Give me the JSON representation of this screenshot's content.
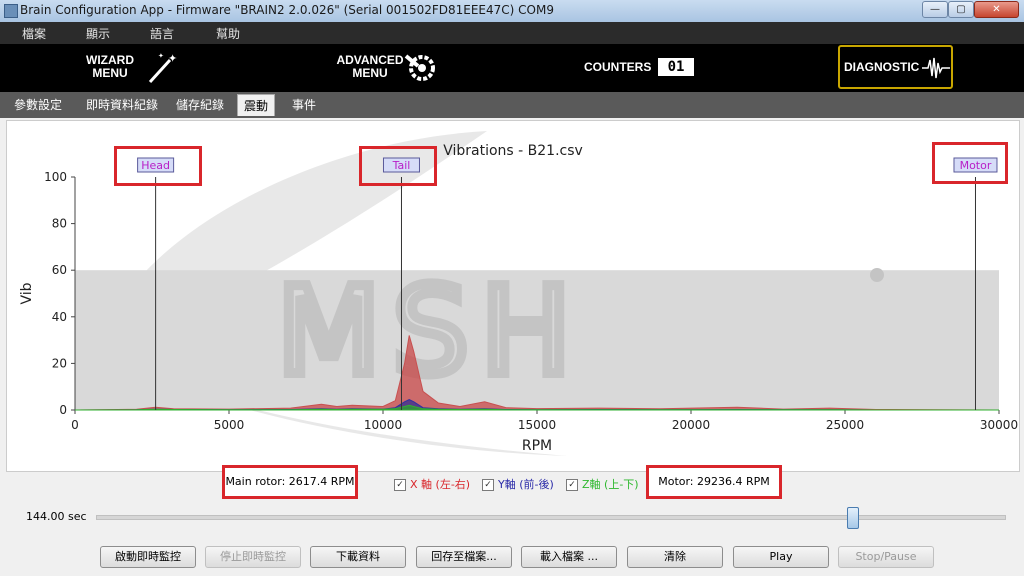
{
  "window": {
    "title": "Brain Configuration App - Firmware \"BRAIN2 2.0.026\" (Serial 001502FD81EEE47C)  COM9",
    "min": "—",
    "max": "▢",
    "close": "✕"
  },
  "menu": {
    "items": [
      "檔案",
      "顯示",
      "語言",
      "幫助"
    ]
  },
  "nav": {
    "wizard": "WIZARD MENU",
    "advanced": "ADVANCED MENU",
    "counters": "COUNTERS",
    "counters_digits": "01",
    "diagnostic": "DIAGNOSTIC"
  },
  "tabs": [
    {
      "label": "參數設定"
    },
    {
      "label": "即時資料紀錄"
    },
    {
      "label": "儲存紀錄"
    },
    {
      "label": "震動",
      "active": true
    },
    {
      "label": "事件"
    }
  ],
  "chart_data": {
    "type": "area",
    "title": "Vibrations - B21.csv",
    "xlabel": "RPM",
    "ylabel": "Vib",
    "xlim": [
      0,
      30000
    ],
    "ylim": [
      0,
      100
    ],
    "x_ticks": [
      0,
      5000,
      10000,
      15000,
      20000,
      25000,
      30000
    ],
    "y_ticks": [
      0,
      20,
      40,
      60,
      80,
      100
    ],
    "markers": [
      {
        "label": "Head",
        "x": 2617.4
      },
      {
        "label": "Tail",
        "x": 10600
      },
      {
        "label": "Motor",
        "x": 29236.4
      }
    ],
    "x": [
      0,
      2000,
      2617,
      3200,
      5000,
      7000,
      8000,
      8500,
      9000,
      10000,
      10400,
      10700,
      10850,
      11000,
      11300,
      11800,
      12500,
      13300,
      14000,
      15000,
      17000,
      19000,
      21500,
      23000,
      24500,
      26000,
      30000
    ],
    "series": [
      {
        "name": "X 軸 (左-右)",
        "color": "#c85050",
        "values": [
          0,
          0.3,
          1.2,
          0.5,
          0.4,
          0.8,
          2.5,
          1.5,
          2.0,
          1.5,
          4.0,
          20,
          32,
          25,
          8,
          3,
          1.5,
          3.5,
          1.0,
          0.6,
          0.8,
          0.5,
          1.2,
          0.4,
          0.8,
          0.2,
          0
        ]
      },
      {
        "name": "Y軸 (前-後)",
        "color": "#3030a0",
        "values": [
          0,
          0.1,
          0.4,
          0.2,
          0.1,
          0.2,
          0.5,
          0.3,
          0.5,
          0.4,
          1.0,
          3.5,
          4.5,
          3.5,
          1.0,
          0.5,
          0.3,
          0.5,
          0.2,
          0.1,
          0.2,
          0.1,
          0.2,
          0.1,
          0.1,
          0.0,
          0
        ]
      },
      {
        "name": "Z軸 (上-下)",
        "color": "#30b030",
        "values": [
          0,
          0.1,
          0.3,
          0.2,
          0.1,
          0.1,
          0.3,
          0.2,
          0.3,
          0.3,
          0.6,
          1.5,
          2.0,
          1.5,
          0.5,
          0.3,
          0.2,
          0.3,
          0.1,
          0.1,
          0.1,
          0.1,
          0.1,
          0.1,
          0.1,
          0.0,
          0
        ]
      }
    ]
  },
  "readouts": {
    "main_rotor": "Main rotor:  2617.4 RPM",
    "motor": "Motor:  29236.4 RPM"
  },
  "checkboxes": [
    {
      "label": "X 軸 (左-右)",
      "color": "#d9262b",
      "checked": true
    },
    {
      "label": "Y軸 (前-後)",
      "color": "#2a2aa8",
      "checked": true
    },
    {
      "label": "Z軸 (上-下)",
      "color": "#2eb82e",
      "checked": true
    }
  ],
  "time_label": "144.00 sec",
  "slider": {
    "fraction": 0.83
  },
  "buttons": [
    {
      "label": "啟動即時監控",
      "enabled": true
    },
    {
      "label": "停止即時監控",
      "enabled": false
    },
    {
      "label": "下載資料",
      "enabled": true
    },
    {
      "label": "回存至檔案...",
      "enabled": true
    },
    {
      "label": "載入檔案 ...",
      "enabled": true
    },
    {
      "label": "清除",
      "enabled": true
    },
    {
      "label": "Play",
      "enabled": true
    },
    {
      "label": "Stop/Pause",
      "enabled": false
    }
  ],
  "watermark": "MSH"
}
